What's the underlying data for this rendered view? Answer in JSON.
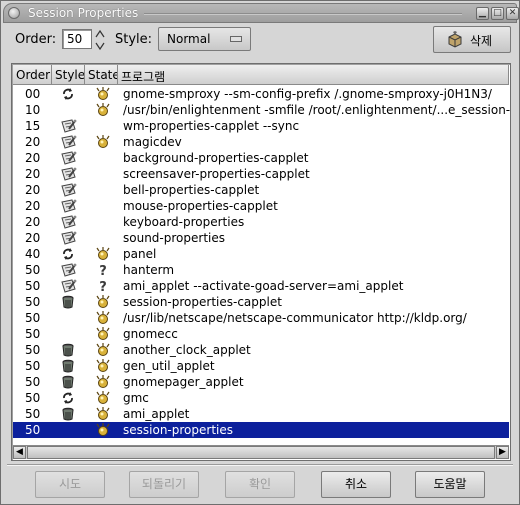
{
  "window": {
    "title": "Session Properties",
    "minimize": "▁",
    "maximize": "□",
    "close": "✕"
  },
  "toolbar": {
    "order_label": "Order:",
    "order_value": "50",
    "style_label": "Style:",
    "style_value": "Normal",
    "delete_label": "삭제"
  },
  "list": {
    "columns": [
      "Order",
      "Style",
      "State",
      "프로그램"
    ],
    "rows": [
      {
        "order": "00",
        "style": "restart",
        "state": "running",
        "program": "gnome-smproxy --sm-config-prefix /.gnome-smproxy-j0H1N3/"
      },
      {
        "order": "10",
        "style": "",
        "state": "running",
        "program": "/usr/bin/enlightenment -smfile /root/.enlightenment/...e_session-XXXX"
      },
      {
        "order": "15",
        "style": "settings",
        "state": "",
        "program": "wm-properties-capplet --sync"
      },
      {
        "order": "20",
        "style": "settings",
        "state": "running",
        "program": "magicdev"
      },
      {
        "order": "20",
        "style": "settings",
        "state": "",
        "program": "background-properties-capplet"
      },
      {
        "order": "20",
        "style": "settings",
        "state": "",
        "program": "screensaver-properties-capplet"
      },
      {
        "order": "20",
        "style": "settings",
        "state": "",
        "program": "bell-properties-capplet"
      },
      {
        "order": "20",
        "style": "settings",
        "state": "",
        "program": "mouse-properties-capplet"
      },
      {
        "order": "20",
        "style": "settings",
        "state": "",
        "program": "keyboard-properties"
      },
      {
        "order": "20",
        "style": "settings",
        "state": "",
        "program": "sound-properties"
      },
      {
        "order": "40",
        "style": "restart",
        "state": "running",
        "program": "panel"
      },
      {
        "order": "50",
        "style": "settings",
        "state": "unknown",
        "program": "hanterm"
      },
      {
        "order": "50",
        "style": "settings",
        "state": "unknown",
        "program": "ami_applet --activate-goad-server=ami_applet"
      },
      {
        "order": "50",
        "style": "trash",
        "state": "running",
        "program": "session-properties-capplet"
      },
      {
        "order": "50",
        "style": "",
        "state": "running",
        "program": "/usr/lib/netscape/netscape-communicator http://kldp.org/"
      },
      {
        "order": "50",
        "style": "",
        "state": "running",
        "program": "gnomecc"
      },
      {
        "order": "50",
        "style": "trash",
        "state": "running",
        "program": "another_clock_applet"
      },
      {
        "order": "50",
        "style": "trash",
        "state": "running",
        "program": "gen_util_applet"
      },
      {
        "order": "50",
        "style": "trash",
        "state": "running",
        "program": "gnomepager_applet"
      },
      {
        "order": "50",
        "style": "restart",
        "state": "running",
        "program": "gmc"
      },
      {
        "order": "50",
        "style": "trash",
        "state": "running",
        "program": "ami_applet"
      },
      {
        "order": "50",
        "style": "",
        "state": "running",
        "program": "session-properties"
      }
    ],
    "selected_index": 21
  },
  "buttons": {
    "try": "시도",
    "revert": "되돌리기",
    "ok": "확인",
    "cancel": "취소",
    "help": "도움말"
  }
}
